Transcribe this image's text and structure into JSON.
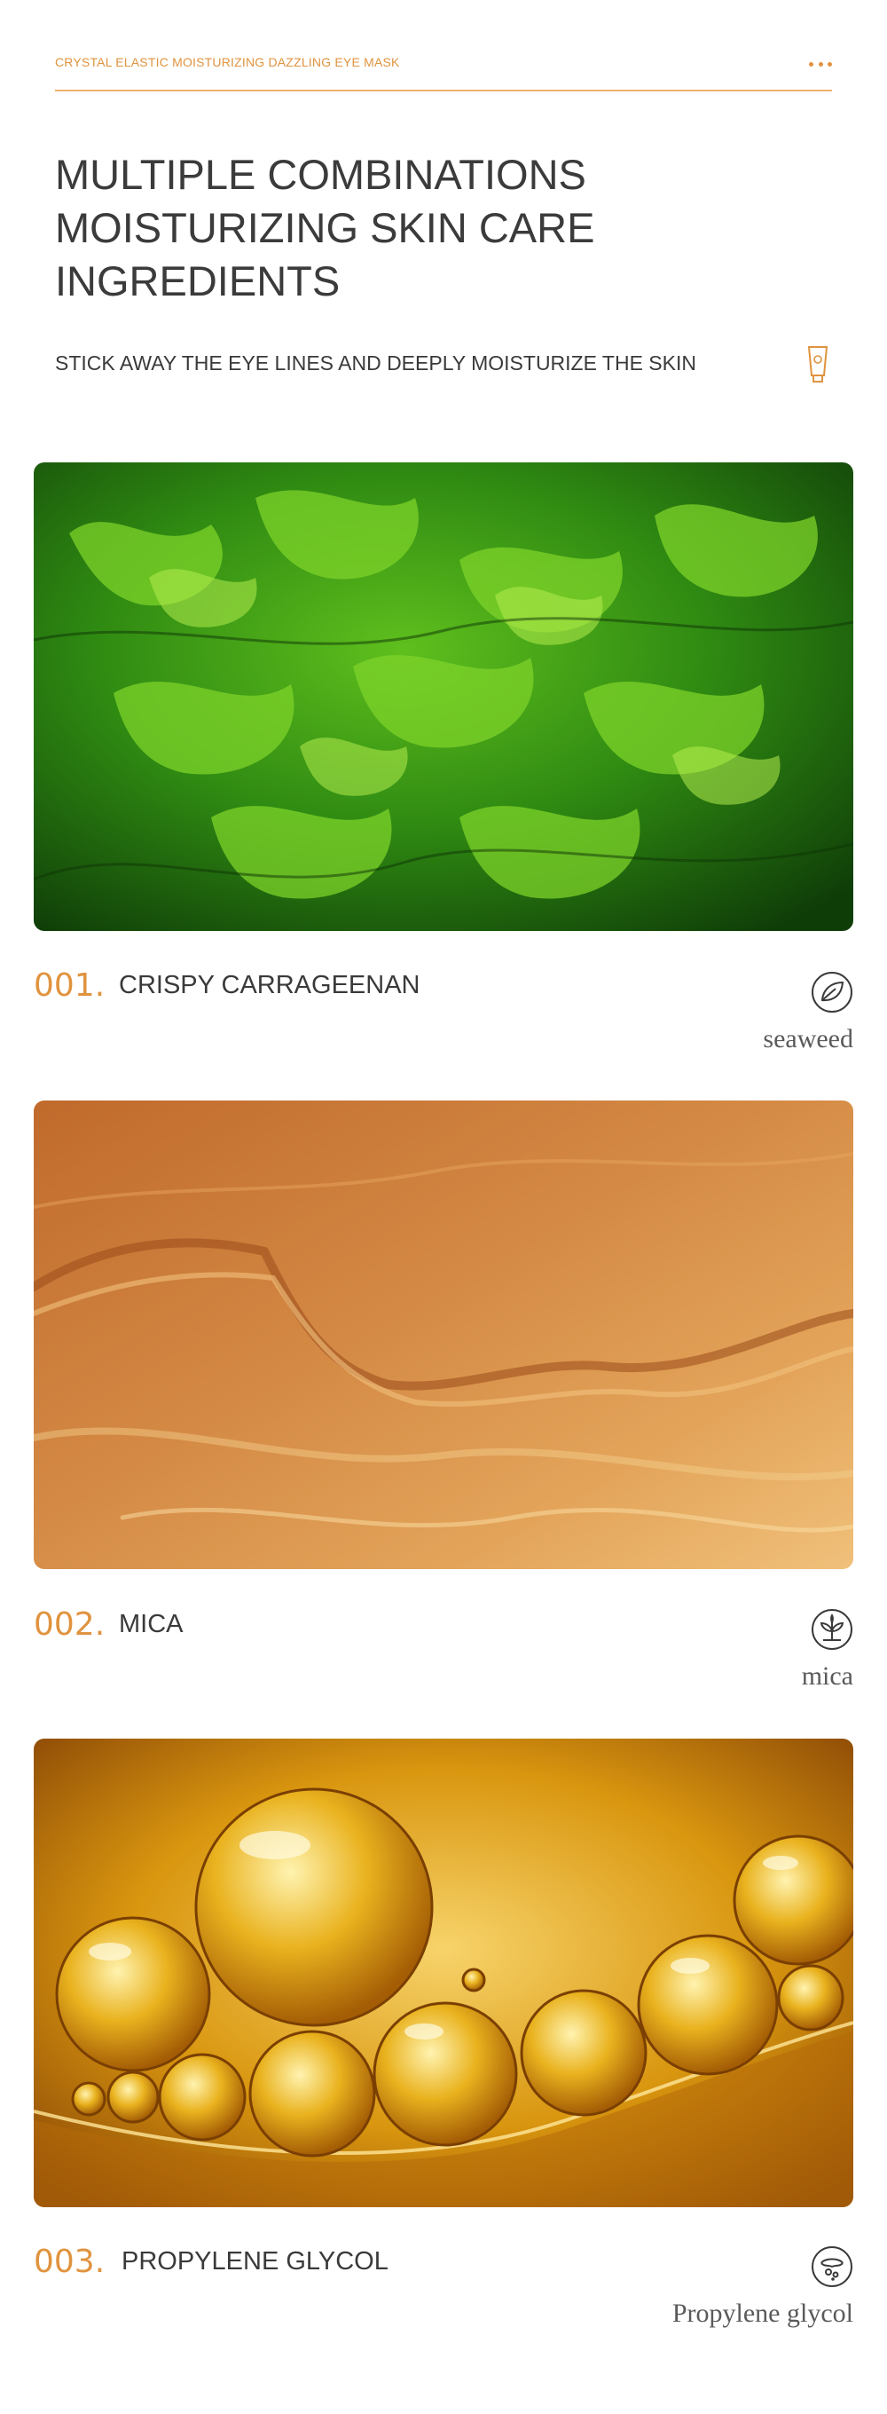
{
  "header": {
    "label": "CRYSTAL ELASTIC MOISTURIZING DAZZLING EYE MASK",
    "more_icon": "more-dots-icon",
    "accent_color": "#e0933f"
  },
  "title": {
    "lines": [
      "MULTIPLE COMBINATIONS",
      "MOISTURIZING SKIN CARE",
      "INGREDIENTS"
    ]
  },
  "subtitle": "STICK AWAY THE EYE LINES AND DEEPLY MOISTURIZE THE SKIN",
  "subtitle_icon": "cream-tube-icon",
  "ingredients": [
    {
      "number": "001.",
      "name": "CRISPY CARRAGEENAN",
      "subtitle": "seaweed",
      "icon": "leaf-icon",
      "image": "green-seaweed-photo"
    },
    {
      "number": "002.",
      "name": "MICA",
      "subtitle": "mica",
      "icon": "plant-sprout-icon",
      "image": "golden-mica-photo"
    },
    {
      "number": "003.",
      "name": "PROPYLENE GLYCOL",
      "subtitle": "Propylene glycol",
      "icon": "bubbles-icon",
      "image": "golden-oil-bubbles-photo"
    }
  ]
}
